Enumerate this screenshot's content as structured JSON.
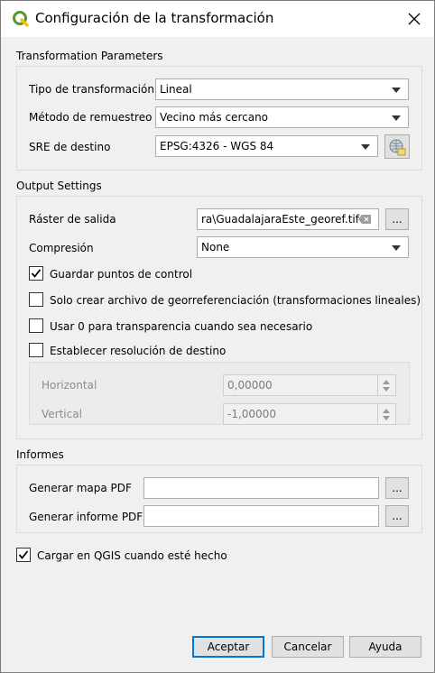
{
  "window": {
    "title": "Configuración de la transformación",
    "close_icon": "close-icon",
    "app_icon": "qgis-logo-icon"
  },
  "transformation_parameters": {
    "title": "Transformation Parameters",
    "type_label": "Tipo de transformación",
    "type_value": "Lineal",
    "resampling_label": "Método de remuestreo",
    "resampling_value": "Vecino más cercano",
    "target_srs_label": "SRE de destino",
    "target_srs_value": "EPSG:4326 - WGS 84",
    "crs_selector_icon": "globe-projection-icon"
  },
  "output_settings": {
    "title": "Output Settings",
    "output_raster_label": "Ráster de salida",
    "output_raster_value": "ra\\GuadalajaraEste_georef.tif",
    "browse_label": "...",
    "compression_label": "Compresión",
    "compression_value": "None",
    "save_gcp_label": "Guardar puntos de control",
    "save_gcp_checked": true,
    "world_file_only_label": "Solo crear archivo de georreferenciación (transformaciones lineales)",
    "world_file_only_checked": false,
    "zero_transparency_label": "Usar 0 para transparencia cuando sea necesario",
    "zero_transparency_checked": false,
    "set_resolution_label": "Establecer resolución de destino",
    "set_resolution_checked": false,
    "horizontal_label": "Horizontal",
    "horizontal_value": "0,00000",
    "vertical_label": "Vertical",
    "vertical_value": "-1,00000"
  },
  "reports": {
    "title": "Informes",
    "pdf_map_label": "Generar mapa PDF",
    "pdf_map_value": "",
    "pdf_report_label": "Generar informe PDF",
    "pdf_report_value": "",
    "browse_label": "..."
  },
  "load_in_qgis": {
    "label": "Cargar en QGIS cuando esté hecho",
    "checked": true
  },
  "buttons": {
    "accept": "Aceptar",
    "cancel": "Cancelar",
    "help": "Ayuda"
  },
  "colors": {
    "accent": "#0078d7",
    "qgis_green": "#589632",
    "qgis_yellow": "#ee7913"
  }
}
